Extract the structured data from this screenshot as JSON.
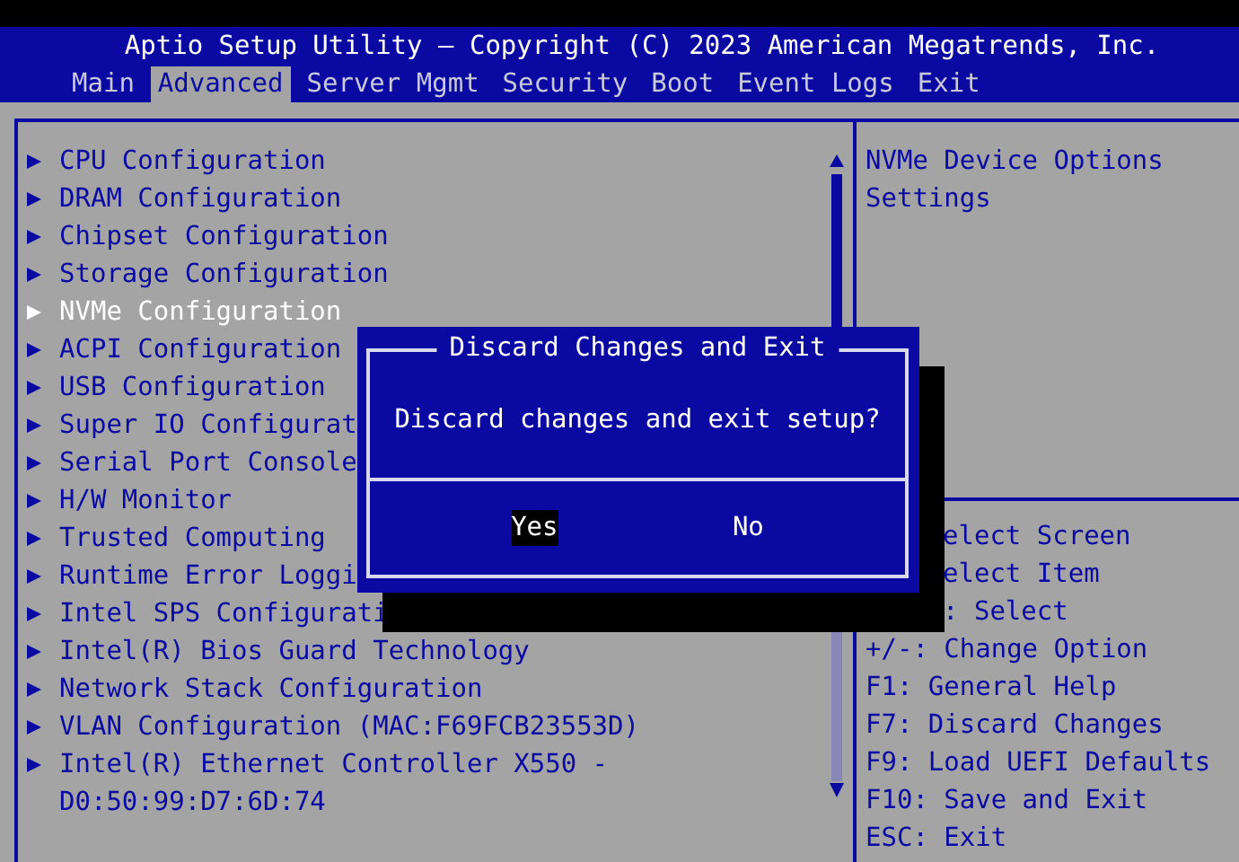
{
  "window": {
    "title": "Aptio Setup Utility – Copyright (C) 2023 American Megatrends, Inc."
  },
  "tabs": [
    {
      "label": "Main",
      "selected": false
    },
    {
      "label": "Advanced",
      "selected": true
    },
    {
      "label": "Server Mgmt",
      "selected": false
    },
    {
      "label": "Security",
      "selected": false
    },
    {
      "label": "Boot",
      "selected": false
    },
    {
      "label": "Event Logs",
      "selected": false
    },
    {
      "label": "Exit",
      "selected": false
    }
  ],
  "menu": {
    "items": [
      {
        "label": "CPU Configuration",
        "selected": false
      },
      {
        "label": "DRAM Configuration",
        "selected": false
      },
      {
        "label": "Chipset Configuration",
        "selected": false
      },
      {
        "label": "Storage Configuration",
        "selected": false
      },
      {
        "label": "NVMe Configuration",
        "selected": true
      },
      {
        "label": "ACPI Configuration",
        "selected": false
      },
      {
        "label": "USB Configuration",
        "selected": false
      },
      {
        "label": "Super IO Configurat",
        "selected": false
      },
      {
        "label": "Serial Port Console",
        "selected": false
      },
      {
        "label": "H/W Monitor",
        "selected": false
      },
      {
        "label": "Trusted Computing",
        "selected": false
      },
      {
        "label": "Runtime Error Loggi",
        "selected": false
      },
      {
        "label": "Intel SPS Configurati",
        "selected": false
      },
      {
        "label": "Intel(R) Bios Guard Technology",
        "selected": false
      },
      {
        "label": "Network Stack Configuration",
        "selected": false
      },
      {
        "label": "VLAN Configuration (MAC:F69FCB23553D)",
        "selected": false
      },
      {
        "label": "Intel(R) Ethernet Controller X550 - D0:50:99:D7:6D:74",
        "selected": false
      }
    ]
  },
  "help": {
    "description": "NVMe Device Options Settings",
    "keys_partly_covered": [
      "elect Screen",
      "elect Item",
      ": Select"
    ],
    "keys": [
      "+/-: Change Option",
      "F1: General Help",
      "F7: Discard Changes",
      "F9: Load UEFI Defaults",
      "F10: Save and Exit",
      "ESC: Exit"
    ]
  },
  "dialog": {
    "title": "Discard Changes and Exit",
    "message": "Discard changes and exit setup?",
    "buttons": [
      {
        "label": "Yes",
        "selected": true
      },
      {
        "label": "No",
        "selected": false
      }
    ]
  }
}
